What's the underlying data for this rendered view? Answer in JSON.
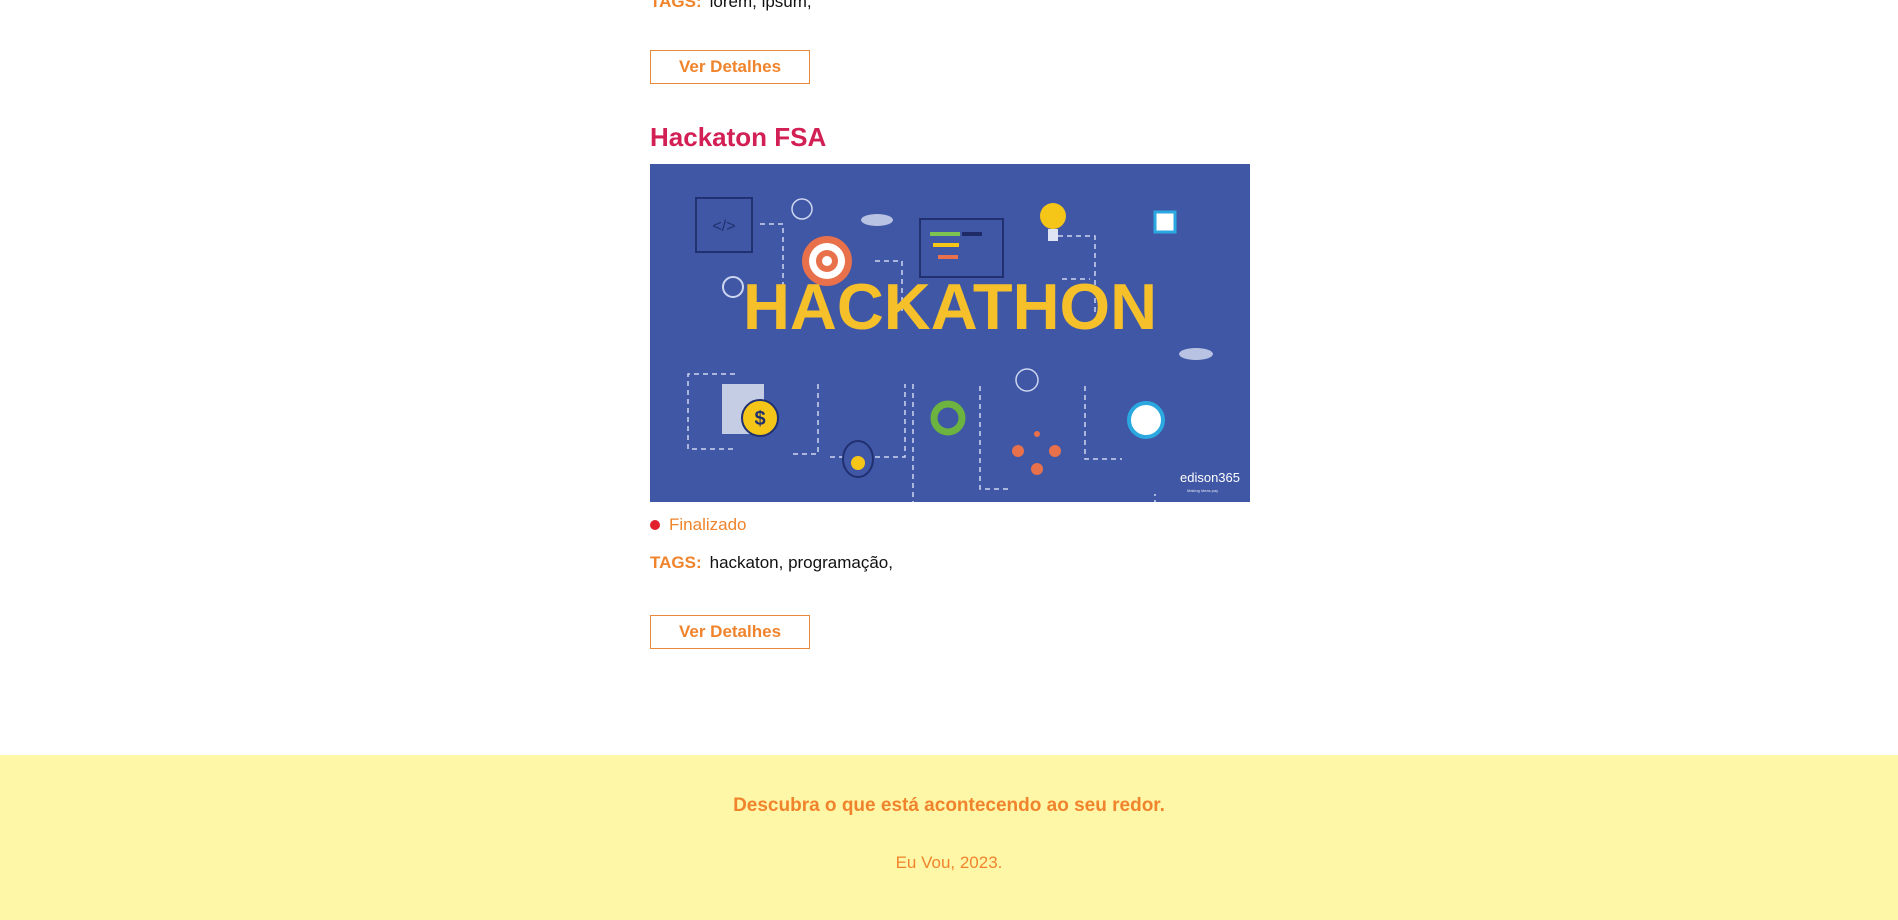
{
  "prev_event": {
    "tags_label": "TAGS:",
    "tags": "lorem,  ipsum,",
    "details_button": "Ver Detalhes"
  },
  "event": {
    "title": "Hackaton FSA",
    "image_text": "HACKATHON",
    "image_brand": "edison365",
    "image_tagline": "Making ideas pay",
    "status": "Finalizado",
    "status_color": "#E0212B",
    "tags_label": "TAGS:",
    "tags": "hackaton,  programação,",
    "details_button": "Ver Detalhes"
  },
  "footer": {
    "tagline": "Descubra o que está acontecendo ao seu redor.",
    "copyright": "Eu Vou, 2023."
  }
}
